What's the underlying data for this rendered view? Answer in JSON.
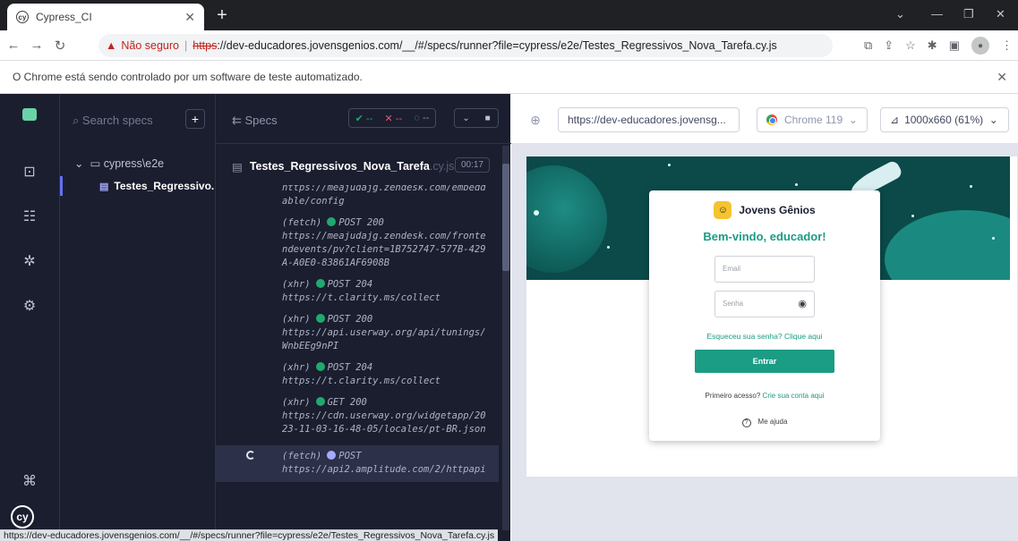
{
  "browser": {
    "tab_title": "Cypress_CI",
    "new_tab": "+",
    "security_label": "Não seguro",
    "url_scheme": "https",
    "url_rest": "://dev-educadores.jovensgenios.com/__/#/specs/runner?file=cypress/e2e/Testes_Regressivos_Nova_Tarefa.cy.js",
    "infobar_text": "O Chrome está sendo controlado por um software de teste automatizado.",
    "status_url": "https://dev-educadores.jovensgenios.com/__/#/specs/runner?file=cypress/e2e/Testes_Regressivos_Nova_Tarefa.cy.js"
  },
  "specs_panel": {
    "search_placeholder": "Search specs",
    "add_button": "+",
    "folder": "cypress\\e2e",
    "file": "Testes_Regressivo..."
  },
  "reporter": {
    "header_label": "Specs",
    "passed": "--",
    "failed": "--",
    "pending": "--",
    "file_name": "Testes_Regressivos_Nova_Tarefa",
    "file_ext": ".cy.js",
    "duration": "00:17",
    "commands": [
      {
        "type": "",
        "method": "",
        "url": "https://meajudajg.zendesk.com/embeddable/config",
        "partial": true
      },
      {
        "type": "(fetch)",
        "method": "POST 200",
        "url": "https://meajudajg.zendesk.com/frontendevents/pv?client=1B752747-577B-429A-A0E0-83861AF6908B"
      },
      {
        "type": "(xhr)",
        "method": "POST 204",
        "url": "https://t.clarity.ms/collect"
      },
      {
        "type": "(xhr)",
        "method": "POST 200",
        "url": "https://api.userway.org/api/tunings/WnbEEg9nPI"
      },
      {
        "type": "(xhr)",
        "method": "POST 204",
        "url": "https://t.clarity.ms/collect"
      },
      {
        "type": "(xhr)",
        "method": "GET 200",
        "url": "https://cdn.userway.org/widgetapp/2023-11-03-16-48-05/locales/pt-BR.json"
      },
      {
        "type": "(fetch)",
        "method": "POST",
        "url": "https://api2.amplitude.com/2/httpapi",
        "active": true
      }
    ]
  },
  "preview": {
    "url": "https://dev-educadores.jovensg...",
    "browser": "Chrome 119",
    "viewport": "1000x660 (61%)"
  },
  "app_under_test": {
    "brand": "Jovens Gênios",
    "welcome": "Bem-vindo, educador!",
    "email_placeholder": "Email",
    "password_placeholder": "Senha",
    "forgot": "Esqueceu sua senha? Clique aqui",
    "submit": "Entrar",
    "first_access": "Primeiro acesso?",
    "create_account": "Crie sua conta aqui",
    "help": "Me ajuda"
  },
  "colors": {
    "cypress_dark": "#1b1e2e",
    "cypress_indigo": "#6470f3",
    "teal_accent": "#1b9c85"
  }
}
